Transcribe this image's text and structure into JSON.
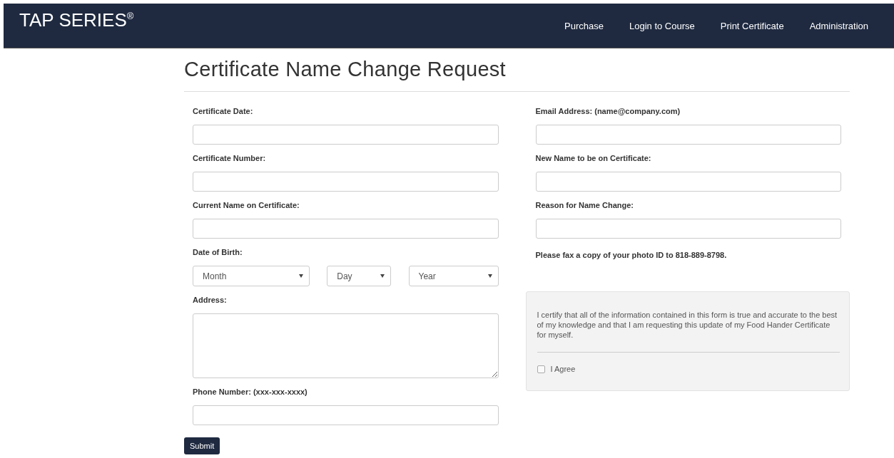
{
  "navbar": {
    "brand": "TAP SERIES$^{®}$",
    "links": [
      "Purchase",
      "Login to Course",
      "Print Certificate",
      "Administration"
    ]
  },
  "page": {
    "title": "Certificate Name Change Request"
  },
  "left_fields": [
    {
      "kind": "text",
      "label": "Certificate Date:"
    },
    {
      "kind": "text",
      "label": "Certificate Number:"
    },
    {
      "kind": "text",
      "label": "Current Name on Certificate:"
    },
    {
      "kind": "selects",
      "label": "Date of Birth:",
      "selects": [
        "Month",
        "Day",
        "Year"
      ]
    },
    {
      "kind": "textarea",
      "label": "Address:"
    },
    {
      "kind": "text",
      "label": "Phone Number: (xxx-xxx-xxxx)"
    }
  ],
  "right_fields": [
    {
      "kind": "text",
      "label": "Email Address: (name@company.com)"
    },
    {
      "kind": "text",
      "label": "New Name to be on Certificate:"
    },
    {
      "kind": "text",
      "label": "Reason for Name Change:"
    },
    {
      "kind": "note",
      "label": "Please fax a copy of your photo ID to 818-889-8798."
    }
  ],
  "certify": {
    "text": "I certify that all of the information contained in this form is true and accurate to the best of my knowledge and that I am requesting this update of my Food Hander Certificate for myself.",
    "agree_label": "I Agree",
    "checked": false
  },
  "submit": "Submit"
}
